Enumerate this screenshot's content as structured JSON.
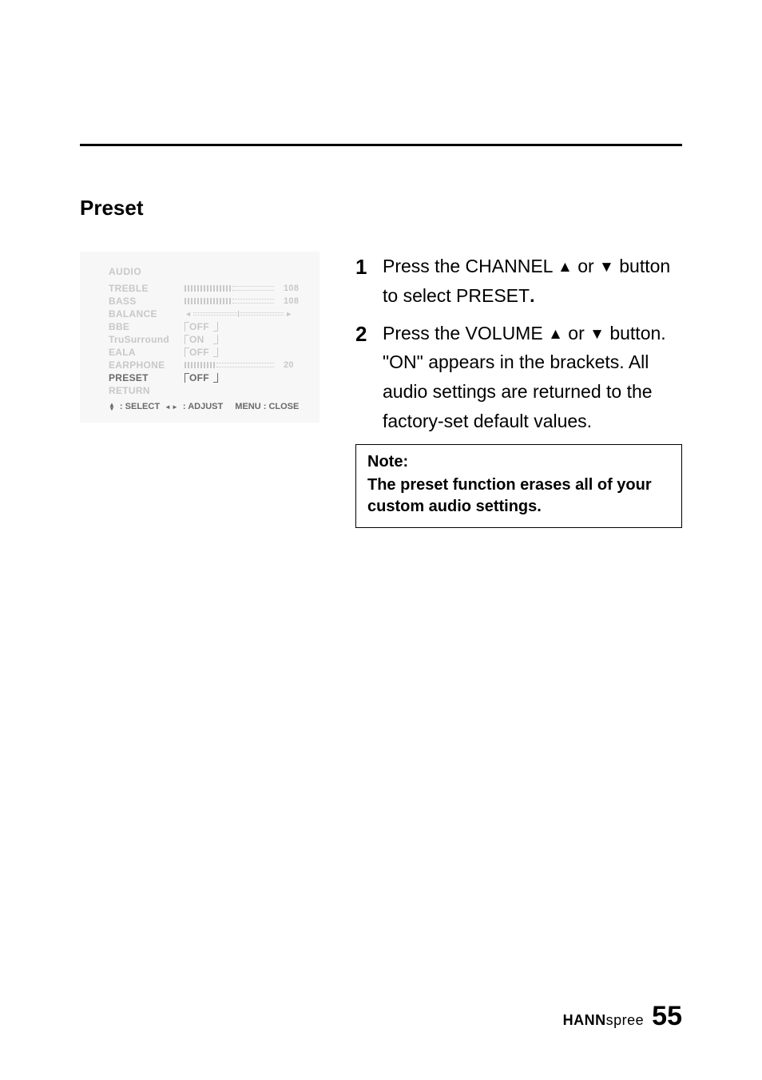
{
  "heading": "Preset",
  "menu": {
    "title": "AUDIO",
    "rows": [
      {
        "label": "TREBLE",
        "type": "bar",
        "value": "108"
      },
      {
        "label": "BASS",
        "type": "bar",
        "value": "108"
      },
      {
        "label": "BALANCE",
        "type": "balance"
      },
      {
        "label": "BBE",
        "type": "bracket",
        "value": "OFF"
      },
      {
        "label": "TruSurround",
        "type": "bracket",
        "value": "ON"
      },
      {
        "label": "EALA",
        "type": "bracket",
        "value": "OFF"
      },
      {
        "label": "EARPHONE",
        "type": "bar-short",
        "value": "20"
      },
      {
        "label": "PRESET",
        "type": "bracket",
        "value": "OFF",
        "selected": true
      },
      {
        "label": "RETURN",
        "type": "none"
      }
    ],
    "footer": {
      "select": ": SELECT",
      "adjust": ": ADJUST",
      "close": "MENU : CLOSE"
    }
  },
  "steps": [
    {
      "num": "1",
      "parts": [
        "Press the CHANNEL ",
        "▲",
        " or ",
        "▼",
        " button to select PRESET",
        "."
      ]
    },
    {
      "num": "2",
      "parts": [
        "Press the VOLUME ",
        "▲",
        " or ",
        "▼",
        " button. \"ON\" appears in the brackets. All audio settings are returned to the factory-set default values."
      ]
    }
  ],
  "note": {
    "title": "Note:",
    "body": "The preset function erases all of your custom audio settings."
  },
  "footer_brand": {
    "bold": "HANN",
    "light": "spree"
  },
  "page_number": "55"
}
